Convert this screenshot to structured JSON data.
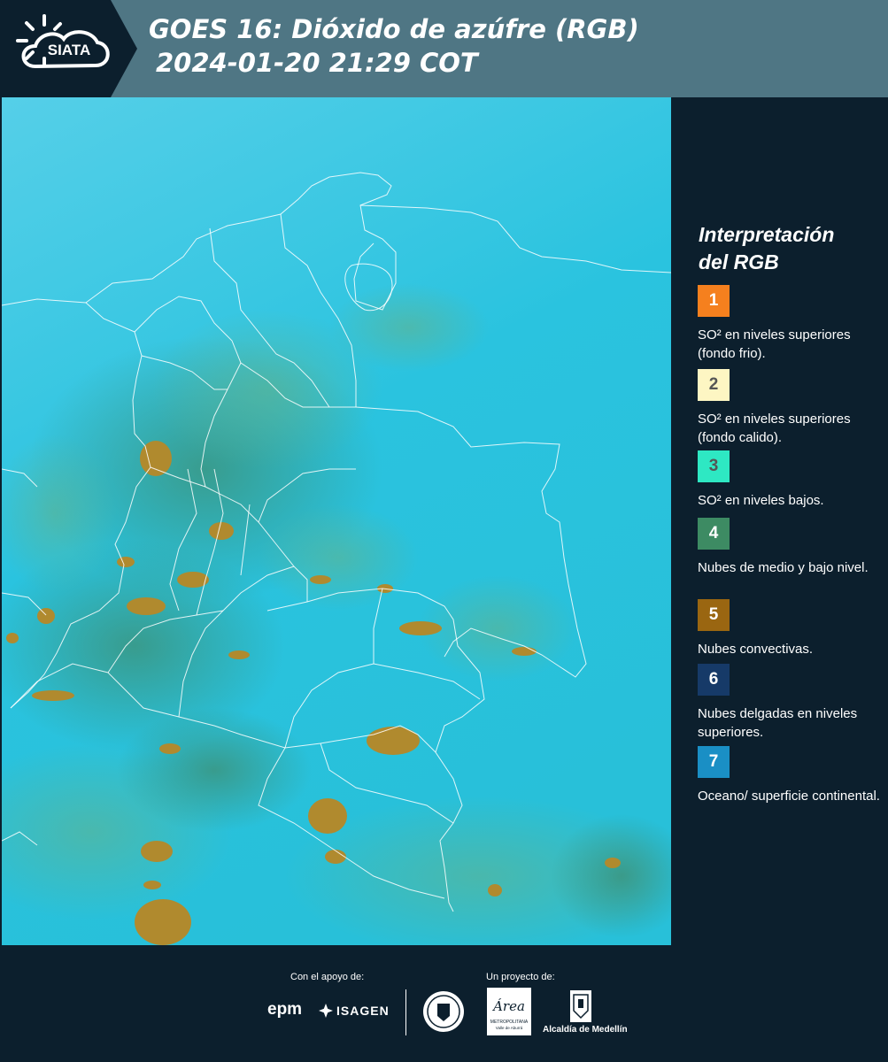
{
  "header": {
    "logo_text": "SIATA",
    "title_line1": "GOES 16: Dióxido de azúfre (RGB)",
    "title_line2": "2024-01-20 21:29 COT"
  },
  "legend": {
    "title_line1": "Interpretación",
    "title_line2": "del RGB",
    "items": [
      {
        "number": "1",
        "color": "#f5801e",
        "text_color": "#ffffff",
        "label": "SO² en niveles superiores (fondo frio)."
      },
      {
        "number": "2",
        "color": "#fdf6c3",
        "text_color": "#555555",
        "label": "SO² en niveles superiores (fondo calido)."
      },
      {
        "number": "3",
        "color": "#2ee8c3",
        "text_color": "#555555",
        "label": "SO² en niveles bajos."
      },
      {
        "number": "4",
        "color": "#3d8b63",
        "text_color": "#ffffff",
        "label": "Nubes de medio y bajo nivel."
      },
      {
        "number": "5",
        "color": "#9a6611",
        "text_color": "#ffffff",
        "label": "Nubes convectivas."
      },
      {
        "number": "6",
        "color": "#163a68",
        "text_color": "#ffffff",
        "label": "Nubes delgadas en niveles superiores."
      },
      {
        "number": "7",
        "color": "#1a8fc5",
        "text_color": "#ffffff",
        "label": "Oceano/ superficie continental."
      }
    ]
  },
  "footer": {
    "support_label": "Con el apoyo de:",
    "project_label": "Un proyecto de:",
    "sponsor_epm": "epm",
    "sponsor_isagen": "ISAGEN",
    "area_logo_text": "Área",
    "area_sub1": "METROPOLITANA",
    "area_sub2": "Valle de Aburrá",
    "medellin_label": "Alcaldía de Medellín"
  },
  "map": {
    "ocean_color": "#27c3e0",
    "cloud_color": "#b0892c"
  }
}
